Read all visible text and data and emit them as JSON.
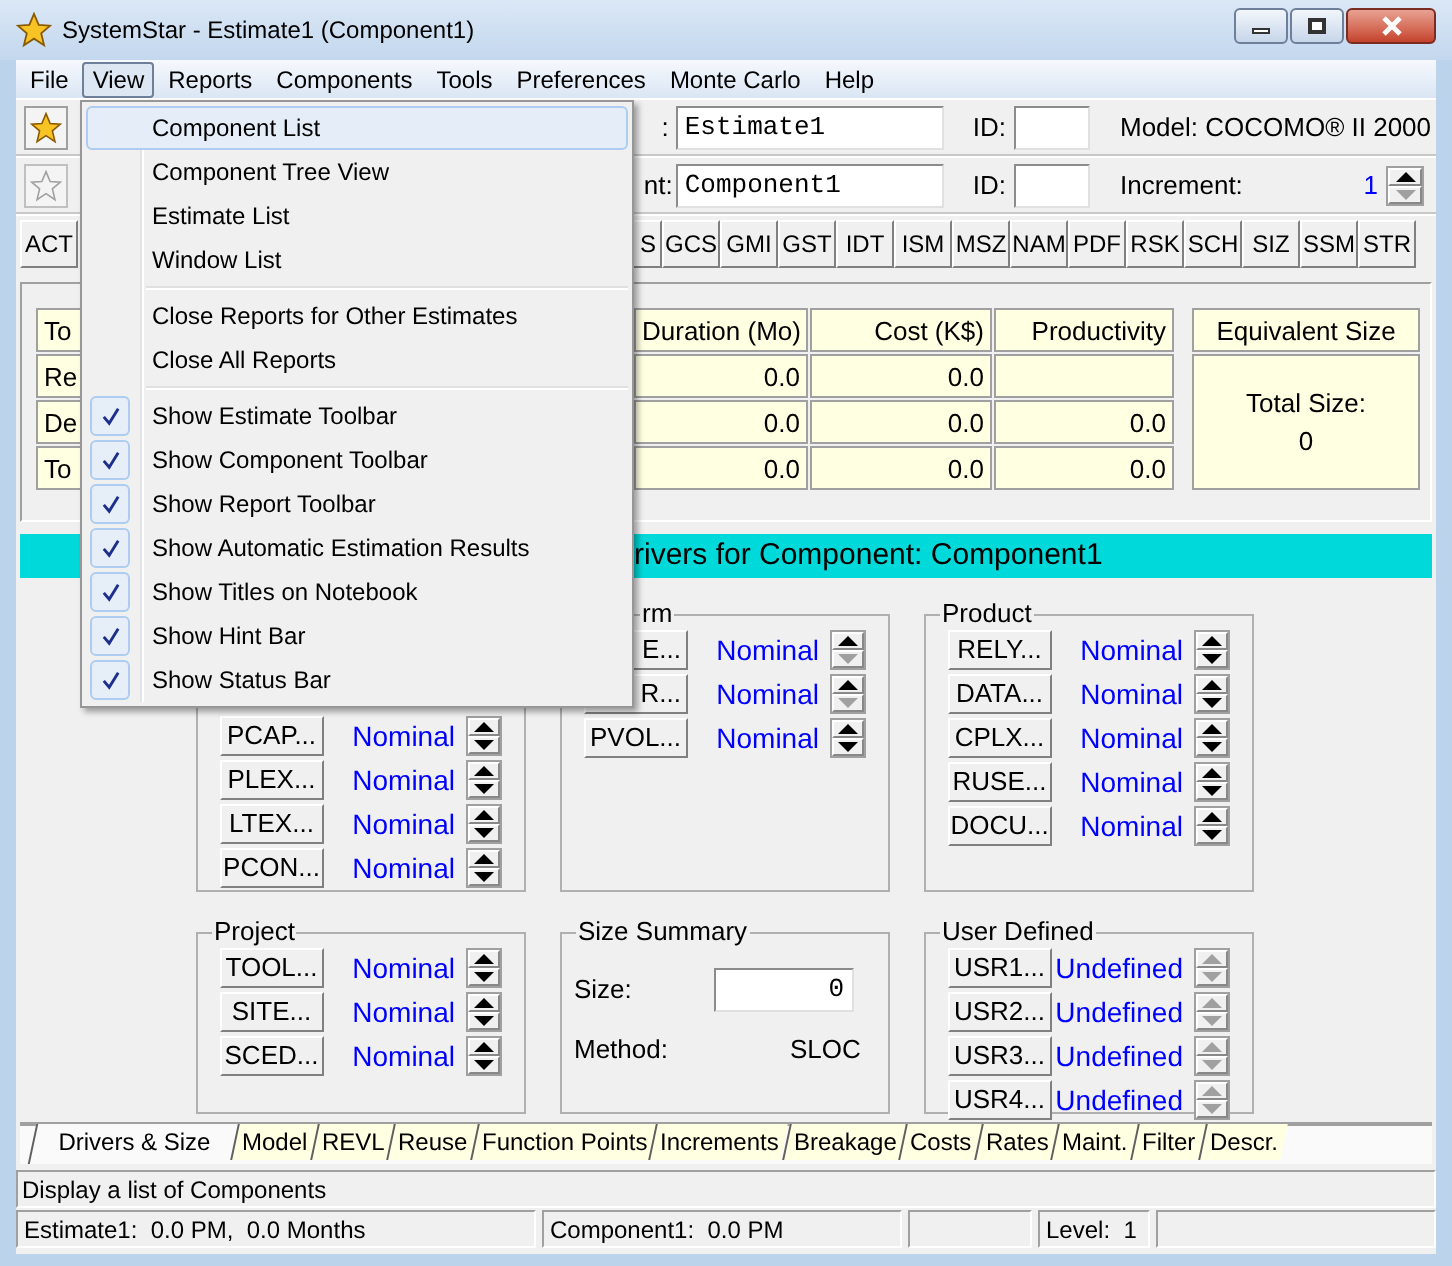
{
  "window": {
    "title": "SystemStar - Estimate1 (Component1)"
  },
  "menu_bar": [
    {
      "label": "File",
      "selected": false
    },
    {
      "label": "View",
      "selected": true
    },
    {
      "label": "Reports",
      "selected": false
    },
    {
      "label": "Components",
      "selected": false
    },
    {
      "label": "Tools",
      "selected": false
    },
    {
      "label": "Preferences",
      "selected": false
    },
    {
      "label": "Monte Carlo",
      "selected": false
    },
    {
      "label": "Help",
      "selected": false
    }
  ],
  "estimate_toolbar": {
    "label": ":",
    "name_value": "Estimate1",
    "id_label": "ID:",
    "model": "Model: COCOMO® II 2000"
  },
  "component_toolbar": {
    "label": "nt:",
    "name_value": "Component1",
    "id_label": "ID:",
    "increment_label": "Increment:",
    "increment_value": "1"
  },
  "report_toolbar": [
    "ACT",
    "S",
    "GCS",
    "GMI",
    "GST",
    "IDT",
    "ISM",
    "MSZ",
    "NAM",
    "PDF",
    "RSK",
    "SCH",
    "SIZ",
    "SSM",
    "STR"
  ],
  "results": {
    "header": [
      "To",
      "Duration (Mo)",
      "Cost (K$)",
      "Productivity"
    ],
    "rows": [
      {
        "label": "Re",
        "duration": "0.0",
        "cost": "0.0"
      },
      {
        "label": "De",
        "duration": "0.0",
        "cost": "0.0",
        "productivity": "0.0"
      },
      {
        "label": "To",
        "duration": "0.0",
        "cost": "0.0",
        "productivity": "0.0"
      }
    ],
    "equivalent_size": {
      "title": "Equivalent Size",
      "label": "Total Size:",
      "value": "0"
    }
  },
  "drivers_title": "rivers for Component: Component1",
  "driver_groups": [
    {
      "kind": "drivers",
      "drivers": [
        {
          "button": "PCAP...",
          "value": "Nominal",
          "up_enabled": true,
          "down_enabled": true
        },
        {
          "button": "PLEX...",
          "value": "Nominal",
          "up_enabled": true,
          "down_enabled": true
        },
        {
          "button": "LTEX...",
          "value": "Nominal",
          "up_enabled": true,
          "down_enabled": true
        },
        {
          "button": "PCON...",
          "value": "Nominal",
          "up_enabled": true,
          "down_enabled": true
        }
      ]
    },
    {
      "kind": "drivers",
      "title": "rm",
      "drivers": [
        {
          "button": "E...",
          "value": "Nominal",
          "up_enabled": true,
          "down_enabled": false
        },
        {
          "button": "R...",
          "value": "Nominal",
          "up_enabled": true,
          "down_enabled": false
        },
        {
          "button": "PVOL...",
          "value": "Nominal",
          "up_enabled": true,
          "down_enabled": true
        }
      ]
    },
    {
      "kind": "drivers",
      "title": "Product",
      "drivers": [
        {
          "button": "RELY...",
          "value": "Nominal",
          "up_enabled": true,
          "down_enabled": true
        },
        {
          "button": "DATA...",
          "value": "Nominal",
          "up_enabled": true,
          "down_enabled": true
        },
        {
          "button": "CPLX...",
          "value": "Nominal",
          "up_enabled": true,
          "down_enabled": true
        },
        {
          "button": "RUSE...",
          "value": "Nominal",
          "up_enabled": true,
          "down_enabled": true
        },
        {
          "button": "DOCU...",
          "value": "Nominal",
          "up_enabled": true,
          "down_enabled": true
        }
      ]
    },
    {
      "kind": "drivers",
      "title": "Project",
      "drivers": [
        {
          "button": "TOOL...",
          "value": "Nominal",
          "up_enabled": true,
          "down_enabled": true
        },
        {
          "button": "SITE...",
          "value": "Nominal",
          "up_enabled": true,
          "down_enabled": true
        },
        {
          "button": "SCED...",
          "value": "Nominal",
          "up_enabled": true,
          "down_enabled": true
        }
      ]
    },
    {
      "kind": "size",
      "title": "Size Summary",
      "size_label": "Size:",
      "size_value": "0",
      "method_label": "Method:",
      "method_value": "SLOC"
    },
    {
      "kind": "drivers",
      "title": "User Defined",
      "drivers": [
        {
          "button": "USR1...",
          "value": "Undefined",
          "up_enabled": false,
          "down_enabled": false
        },
        {
          "button": "USR2...",
          "value": "Undefined",
          "up_enabled": false,
          "down_enabled": false
        },
        {
          "button": "USR3...",
          "value": "Undefined",
          "up_enabled": false,
          "down_enabled": false
        },
        {
          "button": "USR4...",
          "value": "Undefined",
          "up_enabled": false,
          "down_enabled": false
        }
      ]
    }
  ],
  "tabs": [
    {
      "label": "Drivers & Size",
      "selected": true
    },
    {
      "label": "Model",
      "selected": false
    },
    {
      "label": "REVL",
      "selected": false
    },
    {
      "label": "Reuse",
      "selected": false
    },
    {
      "label": "Function Points",
      "selected": false
    },
    {
      "label": "Increments",
      "selected": false
    },
    {
      "label": "Breakage",
      "selected": false
    },
    {
      "label": "Costs",
      "selected": false
    },
    {
      "label": "Rates",
      "selected": false
    },
    {
      "label": "Maint.",
      "selected": false
    },
    {
      "label": "Filter",
      "selected": false
    },
    {
      "label": "Descr.",
      "selected": false
    }
  ],
  "hint_bar": "Display a list of Components",
  "status_bar": [
    "Estimate1:  0.0 PM,  0.0 Months",
    "Component1:  0.0 PM",
    "Level:  1"
  ],
  "view_menu": [
    {
      "kind": "item",
      "label": "Component List",
      "selected": true,
      "checked": false
    },
    {
      "kind": "item",
      "label": "Component Tree View",
      "selected": false,
      "checked": false
    },
    {
      "kind": "item",
      "label": "Estimate List",
      "selected": false,
      "checked": false
    },
    {
      "kind": "item",
      "label": "Window List",
      "selected": false,
      "checked": false
    },
    {
      "kind": "separator"
    },
    {
      "kind": "item",
      "label": "Close Reports for Other Estimates",
      "selected": false,
      "checked": false
    },
    {
      "kind": "item",
      "label": "Close All Reports",
      "selected": false,
      "checked": false
    },
    {
      "kind": "separator"
    },
    {
      "kind": "item",
      "label": "Show Estimate Toolbar",
      "selected": false,
      "checked": true
    },
    {
      "kind": "item",
      "label": "Show Component Toolbar",
      "selected": false,
      "checked": true
    },
    {
      "kind": "item",
      "label": "Show Report Toolbar",
      "selected": false,
      "checked": true
    },
    {
      "kind": "item",
      "label": "Show Automatic Estimation Results",
      "selected": false,
      "checked": true
    },
    {
      "kind": "item",
      "label": "Show Titles on Notebook",
      "selected": false,
      "checked": true
    },
    {
      "kind": "item",
      "label": "Show Hint Bar",
      "selected": false,
      "checked": true
    },
    {
      "kind": "item",
      "label": "Show Status Bar",
      "selected": false,
      "checked": true
    }
  ]
}
